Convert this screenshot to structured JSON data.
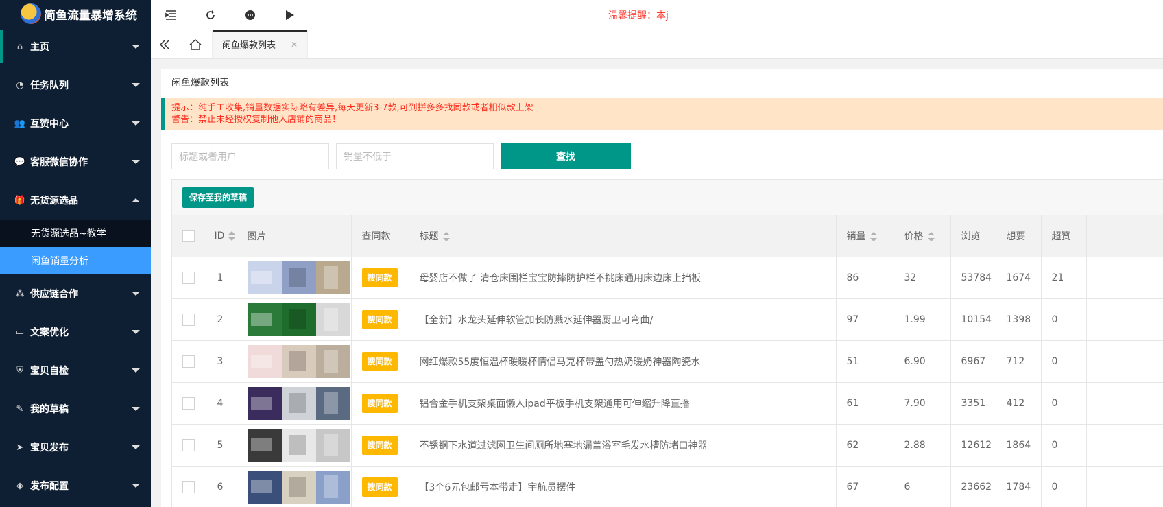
{
  "app": {
    "title": "简鱼流量暴增系统"
  },
  "topbar": {
    "notice": "温馨提醒：本j"
  },
  "sidebar": {
    "items": [
      {
        "label": "主页",
        "icon": "home-icon",
        "glyph": "⌂"
      },
      {
        "label": "任务队列",
        "icon": "gauge-icon",
        "glyph": "◔"
      },
      {
        "label": "互赞中心",
        "icon": "users-icon",
        "glyph": "👥"
      },
      {
        "label": "客服微信协作",
        "icon": "wechat-icon",
        "glyph": "💬"
      },
      {
        "label": "无货源选品",
        "icon": "gift-icon",
        "glyph": "🎁"
      },
      {
        "label": "供应链合作",
        "icon": "network-icon",
        "glyph": "⁂"
      },
      {
        "label": "文案优化",
        "icon": "drive-icon",
        "glyph": "▭"
      },
      {
        "label": "宝贝自检",
        "icon": "shield-icon",
        "glyph": "⛨"
      },
      {
        "label": "我的草稿",
        "icon": "edit-icon",
        "glyph": "✎"
      },
      {
        "label": "宝贝发布",
        "icon": "send-icon",
        "glyph": "➤"
      },
      {
        "label": "发布配置",
        "icon": "cube-icon",
        "glyph": "◈"
      }
    ],
    "subitems": [
      {
        "label": "无货源选品~教学"
      },
      {
        "label": "闲鱼销量分析"
      }
    ]
  },
  "tabs": {
    "active": "闲鱼爆款列表"
  },
  "page": {
    "card_title": "闲鱼爆款列表",
    "tip_line1": "提示：纯手工收集,销量数据实际略有差异,每天更新3-7款,可到拼多多找同款或者相似款上架",
    "tip_line2": "警告：禁止未经授权复制他人店铺的商品！",
    "search": {
      "title_placeholder": "标题或者用户",
      "sales_placeholder": "销量不低于",
      "button": "查找"
    },
    "toolbar": {
      "save_label": "保存至我的草稿"
    }
  },
  "table": {
    "headers": [
      "ID",
      "图片",
      "查同款",
      "标题",
      "销量",
      "价格",
      "浏览",
      "想要",
      "超赞"
    ],
    "same_label": "搜同款",
    "rows": [
      {
        "id": "1",
        "title": "母婴店不做了 清仓床围栏宝宝防摔防护栏不挑床通用床边床上挡板",
        "sales": "86",
        "price": "32",
        "views": "53784",
        "wants": "1674",
        "likes": "21"
      },
      {
        "id": "2",
        "title": "【全新】水龙头延伸软管加长防溅水延伸器厨卫可弯曲/",
        "sales": "97",
        "price": "1.99",
        "views": "10154",
        "wants": "1398",
        "likes": "0"
      },
      {
        "id": "3",
        "title": "网红爆款55度恒温杯暖暖杯情侣马克杯带盖勺热奶暖奶神器陶瓷水",
        "sales": "51",
        "price": "6.90",
        "views": "6967",
        "wants": "712",
        "likes": "0"
      },
      {
        "id": "4",
        "title": "铝合金手机支架桌面懒人ipad平板手机支架通用可伸缩升降直播",
        "sales": "61",
        "price": "7.90",
        "views": "3351",
        "wants": "412",
        "likes": "0"
      },
      {
        "id": "5",
        "title": "不锈钢下水道过滤网卫生间厕所地塞地漏盖浴室毛发水槽防堵口神器",
        "sales": "62",
        "price": "2.88",
        "views": "12612",
        "wants": "1864",
        "likes": "0"
      },
      {
        "id": "6",
        "title": "【3个6元包邮亏本带走】宇航员摆件",
        "sales": "67",
        "price": "6",
        "views": "23662",
        "wants": "1784",
        "likes": "0"
      }
    ]
  },
  "colors": {
    "sidebar": "#0f1f33",
    "accent": "#009688",
    "active_sub": "#3a9cff",
    "warn_button": "#ffb800",
    "notice": "#ff3b30"
  }
}
